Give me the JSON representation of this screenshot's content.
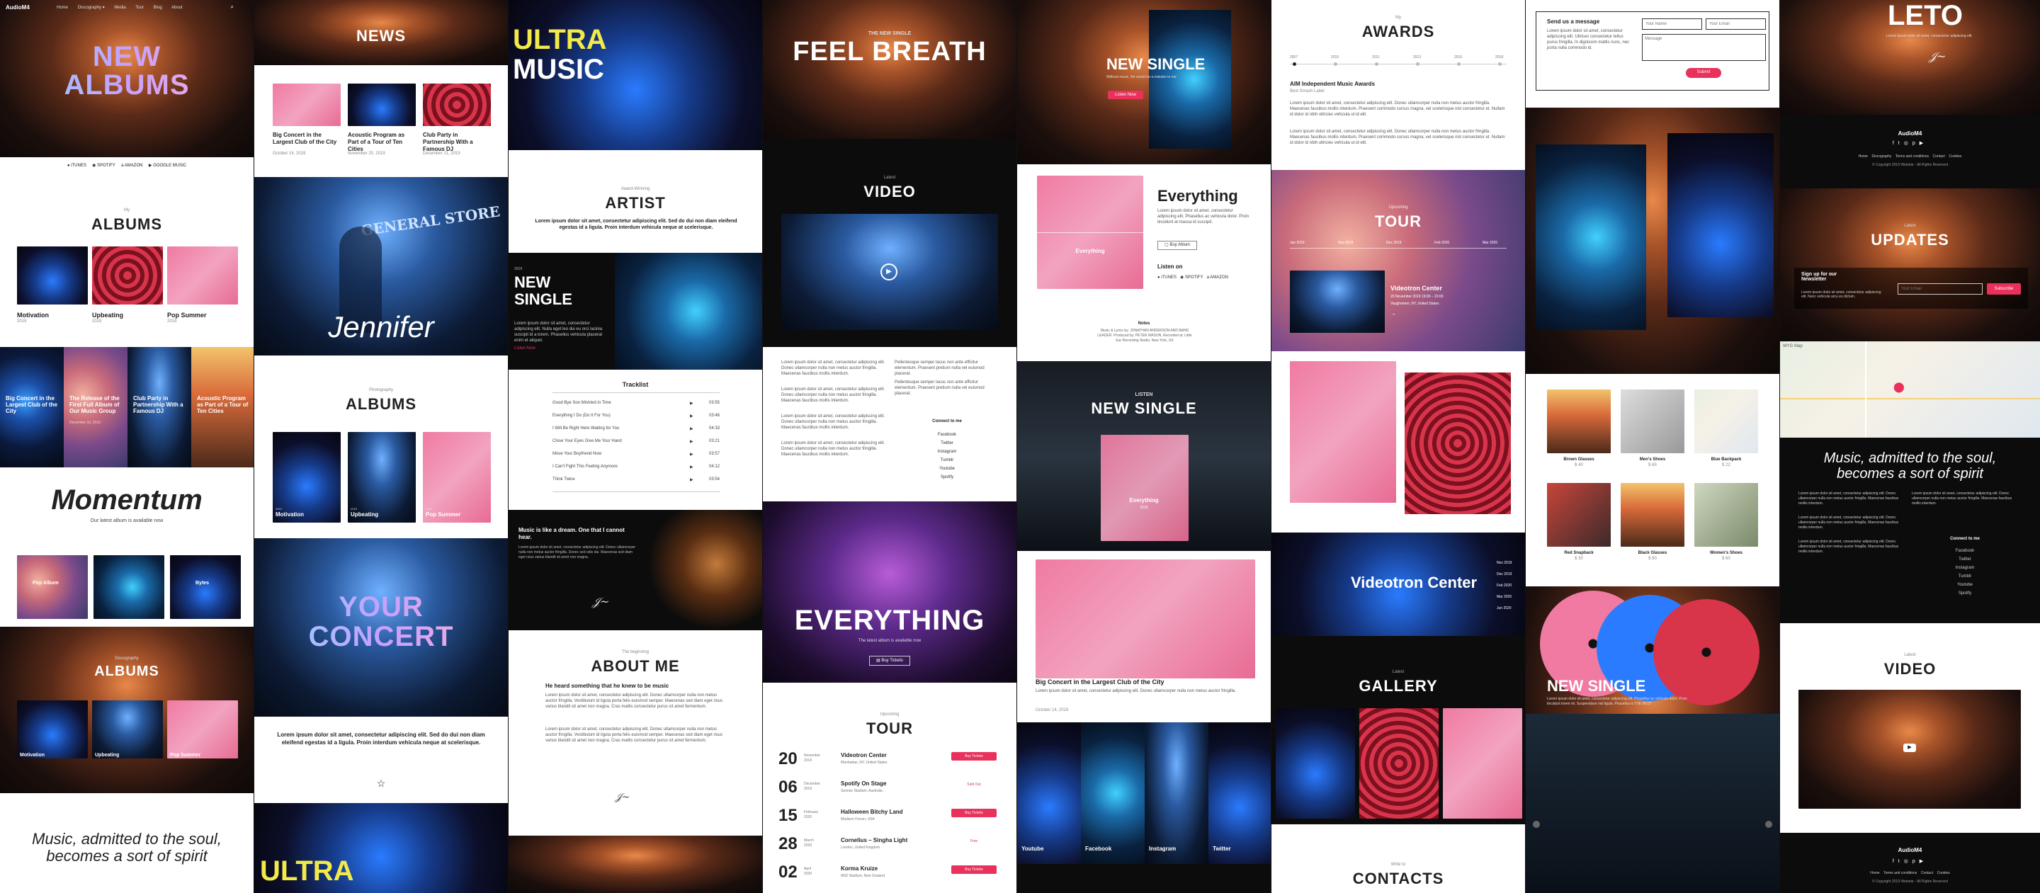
{
  "c1": {
    "brand": "AudioM4",
    "nav": [
      "Home",
      "Discography ▾",
      "Media",
      "Tour",
      "Blog",
      "About"
    ],
    "hero_title": [
      "NEW",
      "ALBUMS"
    ],
    "stores": [
      "iTUNES",
      "SPOTIFY",
      "AMAZON",
      "GOOGLE MUSIC"
    ],
    "my_label": "My",
    "albums_title": "ALBUMS",
    "albums": [
      {
        "name": "Motivation",
        "year": "2019"
      },
      {
        "name": "Upbeating",
        "year": "2019"
      },
      {
        "name": "Pop Summer",
        "year": "2019"
      }
    ],
    "news_cards": [
      "Big Concert in the Largest Club of the City",
      "The Release of the First Full Album of Our Music Group",
      "Club Party in Partnership With a Famous DJ",
      "Acoustic Program as Part of a Tour of Ten Cities"
    ],
    "news_dates": [
      "December 18, 2019",
      "December 16, 2019",
      "December 14, 2019",
      "December 12, 2019"
    ],
    "momentum_title": "Momentum",
    "momentum_sub": "Our latest album is available now",
    "momentum_albums": [
      "Pop Album",
      "",
      "Bytes"
    ],
    "albums2_title": "ALBUMS",
    "albums2_kicker": "Discography",
    "albums2": [
      {
        "name": "Motivation",
        "year": "2019"
      },
      {
        "name": "Upbeating",
        "year": "2019"
      },
      {
        "name": "Pop Summer",
        "year": "2019"
      }
    ],
    "quote": [
      "Music, admitted to the soul,",
      "becomes a sort of spirit"
    ]
  },
  "c2": {
    "news_title": "NEWS",
    "news": [
      {
        "title": "Big Concert in the Largest Club of the City",
        "date": "October 14, 2019"
      },
      {
        "title": "Acoustic Program as Part of a Tour of Ten Cities",
        "date": "November 20, 2019"
      },
      {
        "title": "Club Party in Partnership With a Famous DJ",
        "date": "December 21, 2019"
      }
    ],
    "jennifer": "Jennifer",
    "sign": "GENERAL STORE",
    "photography": "Photography",
    "albums_title": "ALBUMS",
    "albums": [
      {
        "name": "Motivation",
        "year": "2019"
      },
      {
        "name": "Upbeating",
        "year": "2019"
      },
      {
        "name": "Pop Summer",
        "year": "2019"
      }
    ],
    "your_concert": [
      "YOUR",
      "CONCERT"
    ],
    "lorem": "Lorem ipsum dolor sit amet, consectetur adipiscing elit. Sed do dui non diam eleifend egestas id a ligula. Proin interdum vehicula neque at scelerisque.",
    "ultra": "ULTRA"
  },
  "c3": {
    "ultra_music": [
      "ULTRA",
      "MUSIC"
    ],
    "kicker": "Award-Winning",
    "artist_title": "ARTIST",
    "artist_lorem": "Lorem ipsum dolor sit amet, consectetur adipiscing elit. Sed do dui non diam eleifend egestas id a ligula. Proin interdum vehicula neque at scelerisque.",
    "ns_year": "2019",
    "ns_title": [
      "NEW",
      "SINGLE"
    ],
    "ns_text": "Lorem ipsum dolor sit amet, consectetur adipiscing elit. Nulla eget leo dui eu orci lacinia suscipit id a lorem. Phasellus vehicula placerat enim et aliquet.",
    "ns_link": "Listen Now",
    "tracklist_title": "Tracklist",
    "tracks": [
      {
        "name": "Good Bye Son Mistried in Time",
        "time": "03:55"
      },
      {
        "name": "Everything I Do (Do It For You)",
        "time": "03:46"
      },
      {
        "name": "I Will Be Right Here Waiting for You",
        "time": "04:33"
      },
      {
        "name": "Close Your Eyes Give Me Your Hand",
        "time": "03:21"
      },
      {
        "name": "Move Your Boyfriend Now",
        "time": "03:57"
      },
      {
        "name": "I Can't Fight This Feeling Anymore",
        "time": "04:12"
      },
      {
        "name": "Think Twice",
        "time": "03:54"
      }
    ],
    "dream_quote": "Music is like a dream. One that I cannot hear.",
    "dream_text": "Lorem ipsum dolor sit amet, consectetur adipiscing elit. Donec ullamcorper nulla non metus auctor fringilla. Donec sed odio dui. Maecenas sed diam eget risus varius blandit sit amet non magna.",
    "about_kicker": "The beginning",
    "about_title": "ABOUT ME",
    "about_lead": "He heard something that he knew to be music",
    "about_text": "Lorem ipsum dolor sit amet, consectetur adipiscing elit. Donec ullamcorper nulla non metus auctor fringilla. Vestibulum id ligula porta felis euismod semper. Maecenas sed diam eget risus varius blandit sit amet non magna. Cras mattis consectetur purus sit amet fermentum."
  },
  "c4": {
    "kicker": "THE NEW SINGLE",
    "title": "FEEL BREATH",
    "video_kicker": "Latest",
    "video_title": "VIDEO",
    "body_left": "Lorem ipsum dolor sit amet, consectetur adipiscing elit. Donec ullamcorper nulla non metus auctor fringilla. Maecenas faucibus mollis interdum.",
    "body_right": "Pellentesque semper lacus non ante efficitur elementum. Praesent pretium nulla vel euismod placerat.",
    "connect_title": "Connect to me",
    "connect": [
      "Facebook",
      "Twitter",
      "Instagram",
      "Tumblr",
      "Youtube",
      "Spotify"
    ],
    "everything": "EVERYTHING",
    "everything_sub": "The latest album is available now",
    "buy_tickets": "Buy Tickets",
    "tour_kicker": "Upcoming",
    "tour_title": "TOUR",
    "tour": [
      {
        "day": "20",
        "month": "November",
        "year": "2019",
        "venue": "Videotron Center",
        "place": "Manhattan, NY, United States",
        "action": "Buy Tickets",
        "red": true
      },
      {
        "day": "06",
        "month": "December",
        "year": "2019",
        "venue": "Spotify On Stage",
        "place": "Sunrise Stadium, Australia",
        "action": "Sold Out",
        "red": false
      },
      {
        "day": "15",
        "month": "February",
        "year": "2020",
        "venue": "Halloween Bitchy Land",
        "place": "Madison Forum, USA",
        "action": "Buy Tickets",
        "red": true
      },
      {
        "day": "28",
        "month": "March",
        "year": "2020",
        "venue": "Cornelius – Singha Light",
        "place": "London, United Kingdom",
        "action": "Free",
        "red": false
      },
      {
        "day": "02",
        "month": "April",
        "year": "2020",
        "venue": "Korma Kruize",
        "place": "ANZ Stadium, New Zealand",
        "action": "Buy Tickets",
        "red": true
      }
    ]
  },
  "c5": {
    "ns_title": "NEW SINGLE",
    "ns_sub": "Without music, life would be a mistake to me",
    "listen": "Listen Now",
    "ev_title": "Everything",
    "ev_text": "Lorem ipsum dolor sit amet, consectetur adipiscing elit. Phasellus ac vehicula dolor. Proin tincidunt at massa id suscipit.",
    "buy_album": "Buy Album",
    "listen_on": "Listen on",
    "stores": [
      "iTUNES",
      "SPOTIFY",
      "AMAZON"
    ],
    "notes_title": "Notes",
    "notes": "Music & Lyrics by: JONATHAN ANDERSON AND BAND LEADER. Produced by: PETER MASON. Recorded at: Little Ear Recording Studio, New York, US",
    "listen_kicker": "LISTEN",
    "ns2_title": "NEW SINGLE",
    "cover_title": "Everything",
    "cover_year": "2019",
    "blog_title": "Big Concert in the Largest Club of the City",
    "blog_text": "Lorem ipsum dolor sit amet, consectetur adipiscing elit. Donec ullamcorper nulla non metus auctor fringilla.",
    "blog_date": "October 14, 2019",
    "social": [
      "Youtube",
      "Facebook",
      "Instagram",
      "Twitter"
    ]
  },
  "c6": {
    "my": "My",
    "awards_title": "AWARDS",
    "years": [
      "2007",
      "2010",
      "2011",
      "2013",
      "2016",
      "2018"
    ],
    "award_name": "AIM Independent Music Awards",
    "award_sub": "Best Smash Label",
    "award_text": "Lorem ipsum dolor sit amet, consectetur adipiscing elit. Donec ullamcorper nulla non metus auctor fringilla. Maecenas faucibus mollis interdum. Praesent commodo cursus magna, vel scelerisque nisl consectetur et. Nullam id dolor id nibh ultricies vehicula ut id elit.",
    "tour_kicker": "Upcoming",
    "tour_title": "TOUR",
    "tour_dates": [
      "Jan 2019",
      "Nov 2019",
      "Dec 2019",
      "Feb 2020",
      "Mar 2020"
    ],
    "tour_venue": "Videotron Center",
    "tour_when": "20 November 2019 19:00 – 23:00",
    "tour_where": "Vaughnmen, NY, United States",
    "videotron": "Videotron Center",
    "side_dates": [
      "Nov 2019",
      "Dec 2019",
      "Feb 2020",
      "Mar 2020",
      "Jun 2020"
    ],
    "gallery_kicker": "Latest",
    "gallery_title": "GALLERY",
    "contact_kicker": "Write to",
    "contact_title": "CONTACTS"
  },
  "c7": {
    "send_title": "Send us a message",
    "send_text": "Lorem ipsum dolor sit amet, consectetur adipiscing elit. Ultrices consectetur tellus purus fringilla. In dignissim mattis nunc, nec porta nulla commodo id.",
    "name_ph": "Your Name",
    "email_ph": "Your Email",
    "msg_ph": "Message",
    "submit": "Submit",
    "store": [
      {
        "name": "Brown Glasses",
        "price": "$ 40"
      },
      {
        "name": "Men's Shoes",
        "price": "$ 65"
      },
      {
        "name": "Blue Backpack",
        "price": "$ 22"
      },
      {
        "name": "Red Snapback",
        "price": "$ 30"
      },
      {
        "name": "Black Glasses",
        "price": "$ 60"
      },
      {
        "name": "Women's Shoes",
        "price": "$ 60"
      }
    ],
    "ns_title": "NEW SINGLE",
    "ns_text": "Lorem ipsum dolor sit amet, consectetur adipiscing elit. Phasellus ac vehicula dolor. Proin tincidunt lorem mi. Suspendisse nisl ligula. Phasellus is THE BEST",
    "ns_link": "LISTEN NOW"
  },
  "c8": {
    "title": "LETO",
    "sub": "Lorem ipsum dolor sit amet, consectetur adipiscing elit.",
    "brand": "AudioM4",
    "footer_links": [
      "Home",
      "Discography",
      "Terms and conditions",
      "Contact",
      "Cookies"
    ],
    "copyright": "© Copyright 2019 Webstar - All Rights Reserved",
    "updates_kicker": "Latest",
    "updates_title": "UPDATES",
    "signup_title": "Sign up for our Newsletter",
    "signup_text": "Lorem ipsum dolor sit amet, consectetur adipiscing elit. Nunc vehicula arcu eu dictum.",
    "email_ph": "Your Email",
    "subscribe": "Subscribe",
    "map_label": "WYG Map",
    "quote": [
      "Music, admitted to the soul,",
      "becomes a sort of spirit"
    ],
    "quote_text": "Lorem ipsum dolor sit amet, consectetur adipiscing elit. Donec ullamcorper nulla non metus auctor fringilla. Maecenas faucibus mollis interdum.",
    "connect_title": "Connect to me",
    "connect": [
      "Facebook",
      "Twitter",
      "Instagram",
      "Tumblr",
      "Youtube",
      "Spotify"
    ],
    "video_kicker": "Latest",
    "video_title": "VIDEO",
    "brand2": "AudioM4"
  }
}
